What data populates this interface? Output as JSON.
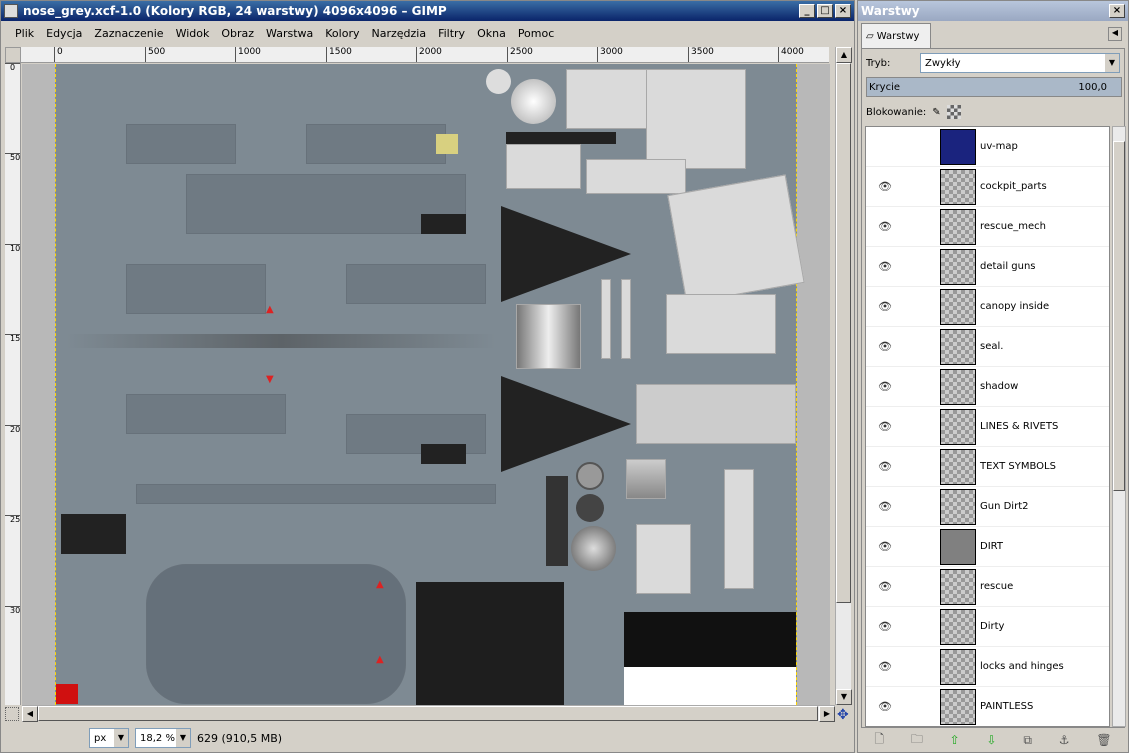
{
  "main": {
    "title": "nose_grey.xcf-1.0 (Kolory RGB, 24 warstwy) 4096x4096 – GIMP",
    "menu": [
      "Plik",
      "Edycja",
      "Zaznaczenie",
      "Widok",
      "Obraz",
      "Warstwa",
      "Kolory",
      "Narzędzia",
      "Filtry",
      "Okna",
      "Pomoc"
    ],
    "ruler_h": [
      "0",
      "500",
      "1000",
      "1500",
      "2000",
      "2500",
      "3000",
      "3500",
      "4000"
    ],
    "ruler_v": [
      "0",
      "500",
      "1000",
      "1500",
      "2000",
      "2500",
      "3000"
    ],
    "status": {
      "unit": "px",
      "zoom": "18,2 %",
      "info": "629 (910,5 MB)"
    }
  },
  "dock": {
    "title": "Warstwy",
    "tab": "Warstwy",
    "mode_label": "Tryb:",
    "mode_value": "Zwykły",
    "opacity_label": "Krycie",
    "opacity_value": "100,0",
    "lock_label": "Blokowanie:",
    "layers": [
      {
        "name": "uv-map",
        "visible": false,
        "thumb": "uv"
      },
      {
        "name": "cockpit_parts",
        "visible": true,
        "thumb": "check"
      },
      {
        "name": "rescue_mech",
        "visible": true,
        "thumb": "check"
      },
      {
        "name": "detail guns",
        "visible": true,
        "thumb": "check"
      },
      {
        "name": "canopy inside",
        "visible": true,
        "thumb": "check"
      },
      {
        "name": "seal.",
        "visible": true,
        "thumb": "check"
      },
      {
        "name": "shadow",
        "visible": true,
        "thumb": "check"
      },
      {
        "name": "LINES & RIVETS",
        "visible": true,
        "thumb": "check"
      },
      {
        "name": "TEXT SYMBOLS",
        "visible": true,
        "thumb": "check"
      },
      {
        "name": "Gun Dirt2",
        "visible": true,
        "thumb": "check"
      },
      {
        "name": "DIRT",
        "visible": true,
        "thumb": "dirt"
      },
      {
        "name": "rescue",
        "visible": true,
        "thumb": "check"
      },
      {
        "name": "Dirty",
        "visible": true,
        "thumb": "check"
      },
      {
        "name": "locks and hinges",
        "visible": true,
        "thumb": "check"
      },
      {
        "name": "PAINTLESS",
        "visible": true,
        "thumb": "check"
      }
    ]
  }
}
